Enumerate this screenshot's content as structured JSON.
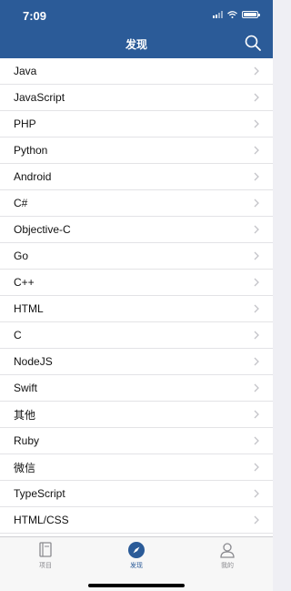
{
  "status_bar": {
    "time": "7:09"
  },
  "header": {
    "title": "发现",
    "search_icon": "search-icon"
  },
  "list": {
    "items": [
      "Java",
      "JavaScript",
      "PHP",
      "Python",
      "Android",
      "C#",
      "Objective-C",
      "Go",
      "C++",
      "HTML",
      "C",
      "NodeJS",
      "Swift",
      "其他",
      "Ruby",
      "微信",
      "TypeScript",
      "HTML/CSS"
    ]
  },
  "tabbar": {
    "tabs": [
      {
        "label": "项目",
        "icon": "book-icon",
        "active": false
      },
      {
        "label": "发现",
        "icon": "compass-icon",
        "active": true
      },
      {
        "label": "我的",
        "icon": "user-icon",
        "active": false
      }
    ]
  },
  "colors": {
    "header": "#2b5b98",
    "accent": "#2b5b98",
    "background": "#efeff4"
  }
}
